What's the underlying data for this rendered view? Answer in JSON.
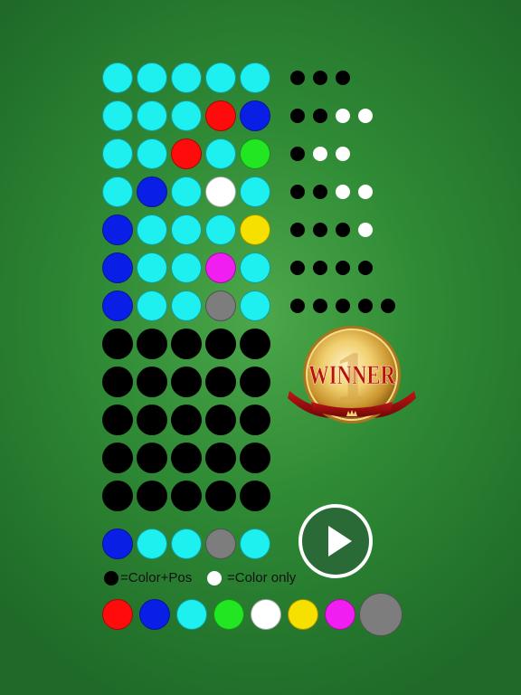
{
  "colors": {
    "cyan": "#1ef0f0",
    "red": "#ff0b0b",
    "blue": "#0a1fe6",
    "green": "#22e622",
    "white": "#ffffff",
    "yellow": "#f5e000",
    "magenta": "#f01ef0",
    "gray": "#7d7d7d",
    "empty": "#000000",
    "fb_black": "#000000",
    "fb_white": "#ffffff"
  },
  "board": {
    "rows": [
      {
        "pegs": [
          "cyan",
          "cyan",
          "cyan",
          "cyan",
          "cyan"
        ],
        "feedback": [
          "black",
          "black",
          "black"
        ]
      },
      {
        "pegs": [
          "cyan",
          "cyan",
          "cyan",
          "red",
          "blue"
        ],
        "feedback": [
          "black",
          "black",
          "white",
          "white"
        ]
      },
      {
        "pegs": [
          "cyan",
          "cyan",
          "red",
          "cyan",
          "green"
        ],
        "feedback": [
          "black",
          "white",
          "white"
        ]
      },
      {
        "pegs": [
          "cyan",
          "blue",
          "cyan",
          "white",
          "cyan"
        ],
        "feedback": [
          "black",
          "black",
          "white",
          "white"
        ]
      },
      {
        "pegs": [
          "blue",
          "cyan",
          "cyan",
          "cyan",
          "yellow"
        ],
        "feedback": [
          "black",
          "black",
          "black",
          "white"
        ]
      },
      {
        "pegs": [
          "blue",
          "cyan",
          "cyan",
          "magenta",
          "cyan"
        ],
        "feedback": [
          "black",
          "black",
          "black",
          "black"
        ]
      },
      {
        "pegs": [
          "blue",
          "cyan",
          "cyan",
          "gray",
          "cyan"
        ],
        "feedback": [
          "black",
          "black",
          "black",
          "black",
          "black"
        ]
      },
      {
        "pegs": [
          "empty",
          "empty",
          "empty",
          "empty",
          "empty"
        ],
        "feedback": []
      },
      {
        "pegs": [
          "empty",
          "empty",
          "empty",
          "empty",
          "empty"
        ],
        "feedback": []
      },
      {
        "pegs": [
          "empty",
          "empty",
          "empty",
          "empty",
          "empty"
        ],
        "feedback": []
      },
      {
        "pegs": [
          "empty",
          "empty",
          "empty",
          "empty",
          "empty"
        ],
        "feedback": []
      },
      {
        "pegs": [
          "empty",
          "empty",
          "empty",
          "empty",
          "empty"
        ],
        "feedback": []
      }
    ]
  },
  "secret_code": [
    "blue",
    "cyan",
    "cyan",
    "gray",
    "cyan"
  ],
  "legend": {
    "exact_label": "=Color+Pos",
    "color_only_label": "=Color only"
  },
  "palette": [
    "red",
    "blue",
    "cyan",
    "green",
    "white",
    "yellow",
    "magenta",
    "gray"
  ],
  "palette_selected": "gray",
  "badge": {
    "text": "WINNER",
    "number": "1"
  },
  "play_button": {
    "icon": "play-icon"
  }
}
